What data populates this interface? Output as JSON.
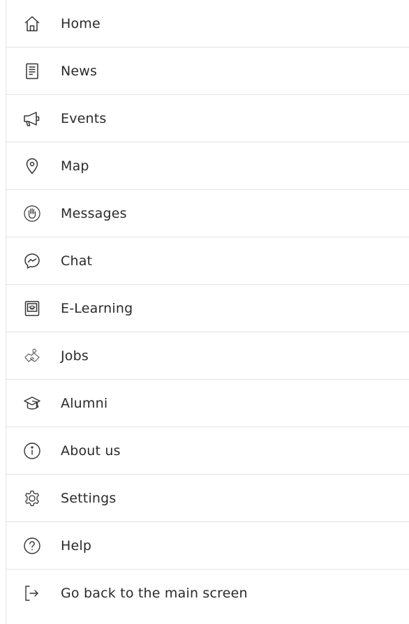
{
  "menu": {
    "items": [
      {
        "label": "Home",
        "icon": "home-icon"
      },
      {
        "label": "News",
        "icon": "newspaper-icon"
      },
      {
        "label": "Events",
        "icon": "megaphone-icon"
      },
      {
        "label": "Map",
        "icon": "map-pin-icon"
      },
      {
        "label": "Messages",
        "icon": "hand-icon"
      },
      {
        "label": "Chat",
        "icon": "messenger-icon"
      },
      {
        "label": "E-Learning",
        "icon": "e-learning-icon"
      },
      {
        "label": "Jobs",
        "icon": "handshake-icon"
      },
      {
        "label": "Alumni",
        "icon": "graduation-cap-icon"
      },
      {
        "label": "About us",
        "icon": "info-icon"
      },
      {
        "label": "Settings",
        "icon": "gear-icon"
      },
      {
        "label": "Help",
        "icon": "help-icon"
      },
      {
        "label": "Go back to the main screen",
        "icon": "logout-icon"
      }
    ]
  }
}
